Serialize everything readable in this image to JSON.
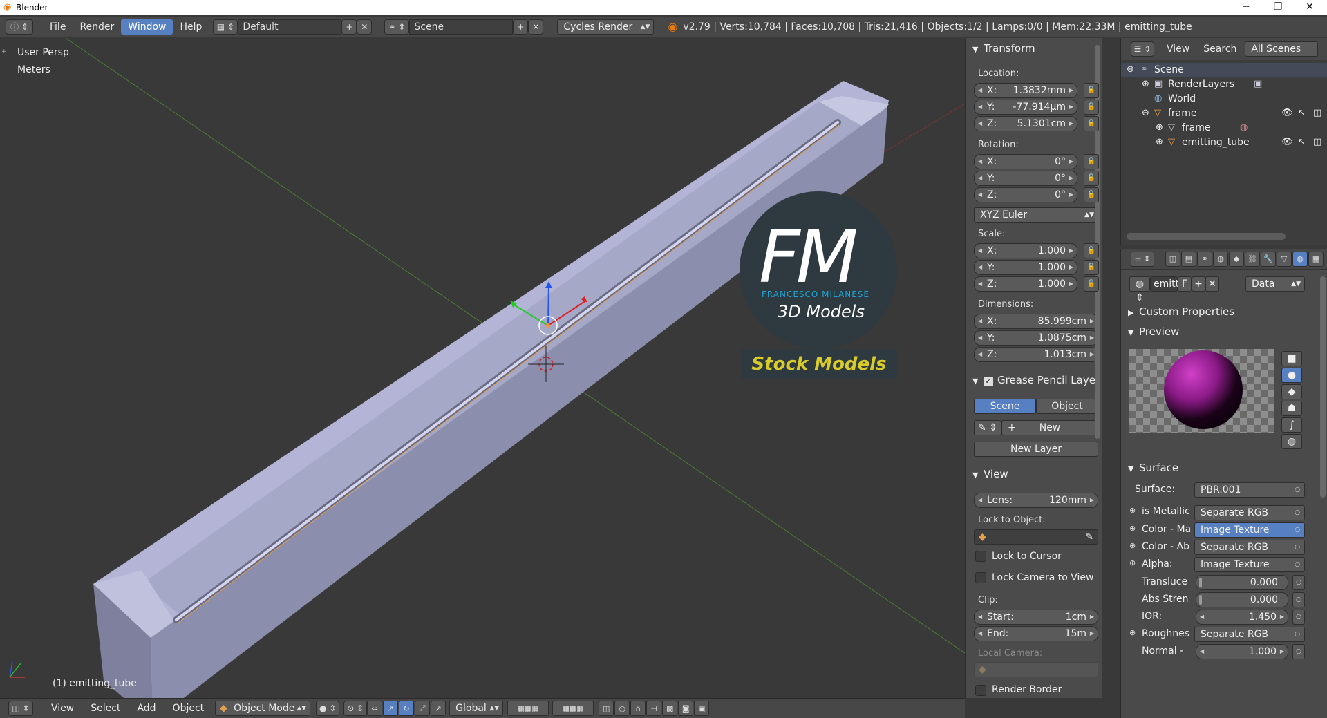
{
  "window": {
    "title": "Blender",
    "controls": [
      "─",
      "❐",
      "✕"
    ]
  },
  "topbar": {
    "menus": [
      "File",
      "Render",
      "Window",
      "Help"
    ],
    "active_menu": "Window",
    "screen_layout": "Default",
    "scene": "Scene",
    "render_engine": "Cycles Render",
    "stats": "v2.79 | Verts:10,784 | Faces:10,708 | Tris:21,416 | Objects:1/2 | Lamps:0/0 | Mem:22.33M | emitting_tube"
  },
  "viewport": {
    "view_label": "User Persp",
    "units_label": "Meters",
    "object_label": "(1) emitting_tube",
    "watermark": {
      "initials": "FM",
      "author": "FRANCESCO MILANESE",
      "subtitle": "3D Models",
      "banner": "Stock Models"
    }
  },
  "npanel": {
    "transform": {
      "title": "Transform",
      "location_label": "Location:",
      "location": [
        {
          "k": "X:",
          "v": "1.3832mm"
        },
        {
          "k": "Y:",
          "v": "-77.914µm"
        },
        {
          "k": "Z:",
          "v": "5.1301cm"
        }
      ],
      "rotation_label": "Rotation:",
      "rotation": [
        {
          "k": "X:",
          "v": "0°"
        },
        {
          "k": "Y:",
          "v": "0°"
        },
        {
          "k": "Z:",
          "v": "0°"
        }
      ],
      "rotation_mode": "XYZ Euler",
      "scale_label": "Scale:",
      "scale": [
        {
          "k": "X:",
          "v": "1.000"
        },
        {
          "k": "Y:",
          "v": "1.000"
        },
        {
          "k": "Z:",
          "v": "1.000"
        }
      ],
      "dimensions_label": "Dimensions:",
      "dimensions": [
        {
          "k": "X:",
          "v": "85.999cm"
        },
        {
          "k": "Y:",
          "v": "1.0875cm"
        },
        {
          "k": "Z:",
          "v": "1.013cm"
        }
      ]
    },
    "grease_pencil": {
      "title": "Grease Pencil Layer",
      "tabs": [
        "Scene",
        "Object"
      ],
      "active_tab": "Scene",
      "new_label": "New",
      "new_layer_label": "New Layer"
    },
    "view": {
      "title": "View",
      "lens_label": "Lens:",
      "lens_value": "120mm",
      "lock_to_object_label": "Lock to Object:",
      "lock_to_cursor": "Lock to Cursor",
      "lock_camera": "Lock Camera to View",
      "clip_label": "Clip:",
      "clip_start_label": "Start:",
      "clip_start": "1cm",
      "clip_end_label": "End:",
      "clip_end": "15m",
      "local_camera_label": "Local Camera:",
      "render_border": "Render Border"
    }
  },
  "outliner": {
    "menus": [
      "View",
      "Search"
    ],
    "filter": "All Scenes",
    "rows": [
      {
        "label": "Scene",
        "icon": "scene-icon"
      },
      {
        "label": "RenderLayers",
        "icon": "renderlayers-icon"
      },
      {
        "label": "World",
        "icon": "world-icon"
      },
      {
        "label": "frame",
        "icon": "mesh-object-icon"
      },
      {
        "label": "frame",
        "icon": "mesh-data-icon"
      },
      {
        "label": "emitting_tube",
        "icon": "mesh-object-icon"
      }
    ]
  },
  "properties": {
    "material_slot_name": "emitti",
    "material_slot_f": "F",
    "data_dropdown": "Data",
    "custom_properties": "Custom Properties",
    "preview_title": "Preview",
    "surface_title": "Surface",
    "surface_label": "Surface:",
    "surface_value": "PBR.001",
    "inputs": [
      {
        "label": "is Metallic",
        "value": "Separate RGB",
        "type": "link"
      },
      {
        "label": "Color - Ma",
        "value": "Image Texture",
        "type": "link-active"
      },
      {
        "label": "Color - Ab",
        "value": "Separate RGB",
        "type": "link"
      },
      {
        "label": "Alpha:",
        "value": "Image Texture",
        "type": "link"
      },
      {
        "label": "Transluce",
        "value": "0.000",
        "type": "slider"
      },
      {
        "label": "Abs Stren",
        "value": "0.000",
        "type": "slider"
      },
      {
        "label": "IOR:",
        "value": "1.450",
        "type": "slider"
      },
      {
        "label": "Roughnes",
        "value": "Separate RGB",
        "type": "link"
      },
      {
        "label": "Normal -",
        "value": "1.000",
        "type": "slider"
      }
    ]
  },
  "bottombar": {
    "menus": [
      "View",
      "Select",
      "Add",
      "Object"
    ],
    "mode": "Object Mode",
    "orientation": "Global"
  },
  "colors": {
    "accent": "#5680c2",
    "panel": "#4b4b4b",
    "viewport": "#393939",
    "mesh": "#9a9cc0",
    "banner_text": "#d8cc2a"
  }
}
